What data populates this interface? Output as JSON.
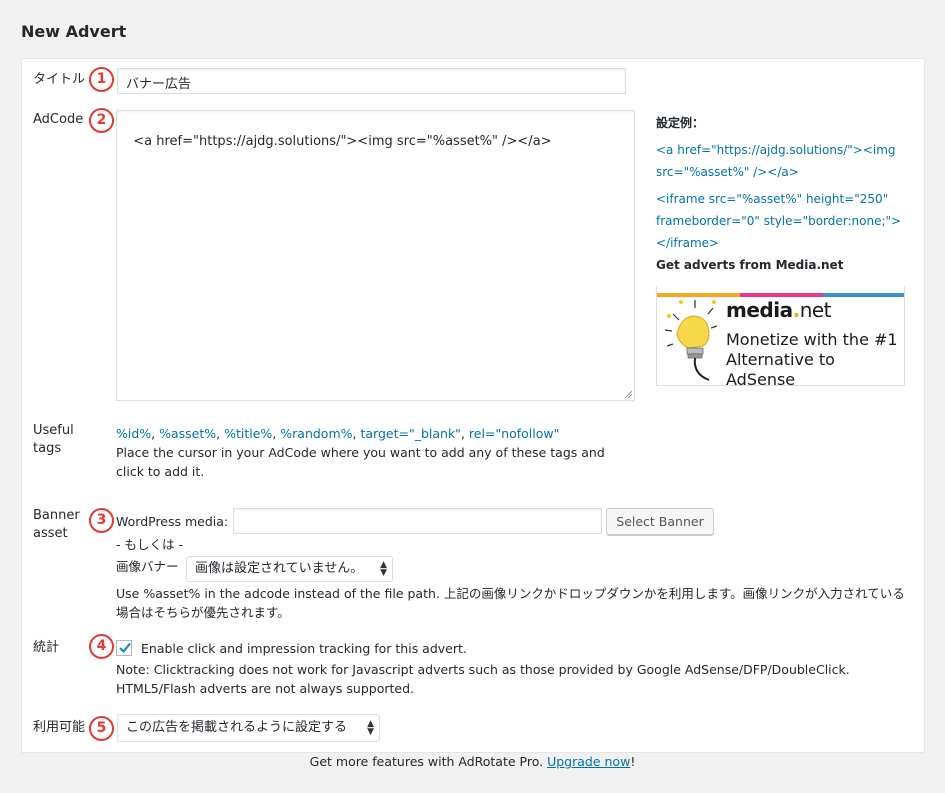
{
  "page": {
    "title": "New Advert"
  },
  "fields": {
    "title": {
      "label": "タイトル",
      "badge": "1",
      "value": "バナー広告"
    },
    "adcode": {
      "label": "AdCode",
      "badge": "2",
      "value": "<a href=\"https://ajdg.solutions/\"><img src=\"%asset%\" /></a>"
    },
    "useful_tags": {
      "label": "Useful tags",
      "tags": [
        "%id%",
        "%asset%",
        "%title%",
        "%random%",
        "target=\"_blank\"",
        "rel=\"nofollow\""
      ],
      "hint": "Place the cursor in your AdCode where you want to add any of these tags and click to add it."
    },
    "banner": {
      "label": "Banner asset",
      "badge": "3",
      "wp_media_label": "WordPress media:",
      "wp_media_value": "",
      "select_button": "Select Banner",
      "or_text": "- もしくは -",
      "image_banner_label": "画像バナー",
      "image_select": "画像は設定されていません。",
      "note": "Use %asset% in the adcode instead of the file path. 上記の画像リンクかドロップダウンかを利用します。画像リンクが入力されている場合はそちらが優先されます。"
    },
    "stats": {
      "label": "統計",
      "badge": "4",
      "checked": true,
      "checkbox_label": "Enable click and impression tracking for this advert.",
      "note": "Note: Clicktracking does not work for Javascript adverts such as those provided by Google AdSense/DFP/DoubleClick. HTML5/Flash adverts are not always supported."
    },
    "availability": {
      "label": "利用可能",
      "badge": "5",
      "select": "この広告を掲載されるように設定する"
    }
  },
  "sidebar": {
    "example_title": "設定例：",
    "example_1": "<a href=\"https://ajdg.solutions/\"><img src=\"%asset%\" /></a>",
    "example_2": "<iframe src=\"%asset%\" height=\"250\" frameborder=\"0\" style=\"border:none;\"></iframe>",
    "media_heading": "Get adverts from Media.net",
    "media_logo_main": "media",
    "media_logo_dot": ".",
    "media_logo_tld": "net",
    "media_tagline": "Monetize with the #1 Alternative to AdSense",
    "media_bar_colors": [
      "#f5a623",
      "#e8388d",
      "#3a8fd9"
    ]
  },
  "footer": {
    "text": "Get more features with AdRotate Pro. ",
    "link": "Upgrade now",
    "suffix": "!"
  },
  "colors": {
    "badge": "#e23a32",
    "link": "#0073aa"
  }
}
